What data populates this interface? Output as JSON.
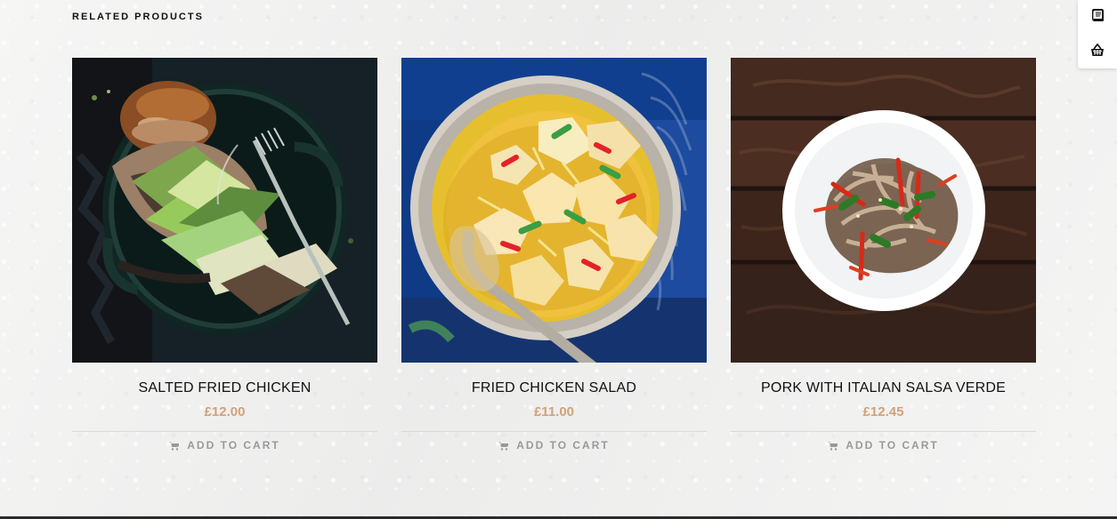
{
  "section": {
    "title": "RELATED PRODUCTS"
  },
  "products": [
    {
      "name": "SALTED FRIED CHICKEN",
      "price": "£12.00",
      "button": "ADD TO CART",
      "image_icon": "chicken-burger-image"
    },
    {
      "name": "FRIED CHICKEN SALAD",
      "price": "£11.00",
      "button": "ADD TO CART",
      "image_icon": "chicken-salad-image"
    },
    {
      "name": "PORK WITH ITALIAN SALSA VERDE",
      "price": "£12.45",
      "button": "ADD TO CART",
      "image_icon": "noodles-image"
    }
  ],
  "floating_toolbar": {
    "icons": [
      "book-icon",
      "basket-icon"
    ]
  },
  "colors": {
    "price": "#d0a27a",
    "text": "#111111",
    "muted": "#999999"
  }
}
